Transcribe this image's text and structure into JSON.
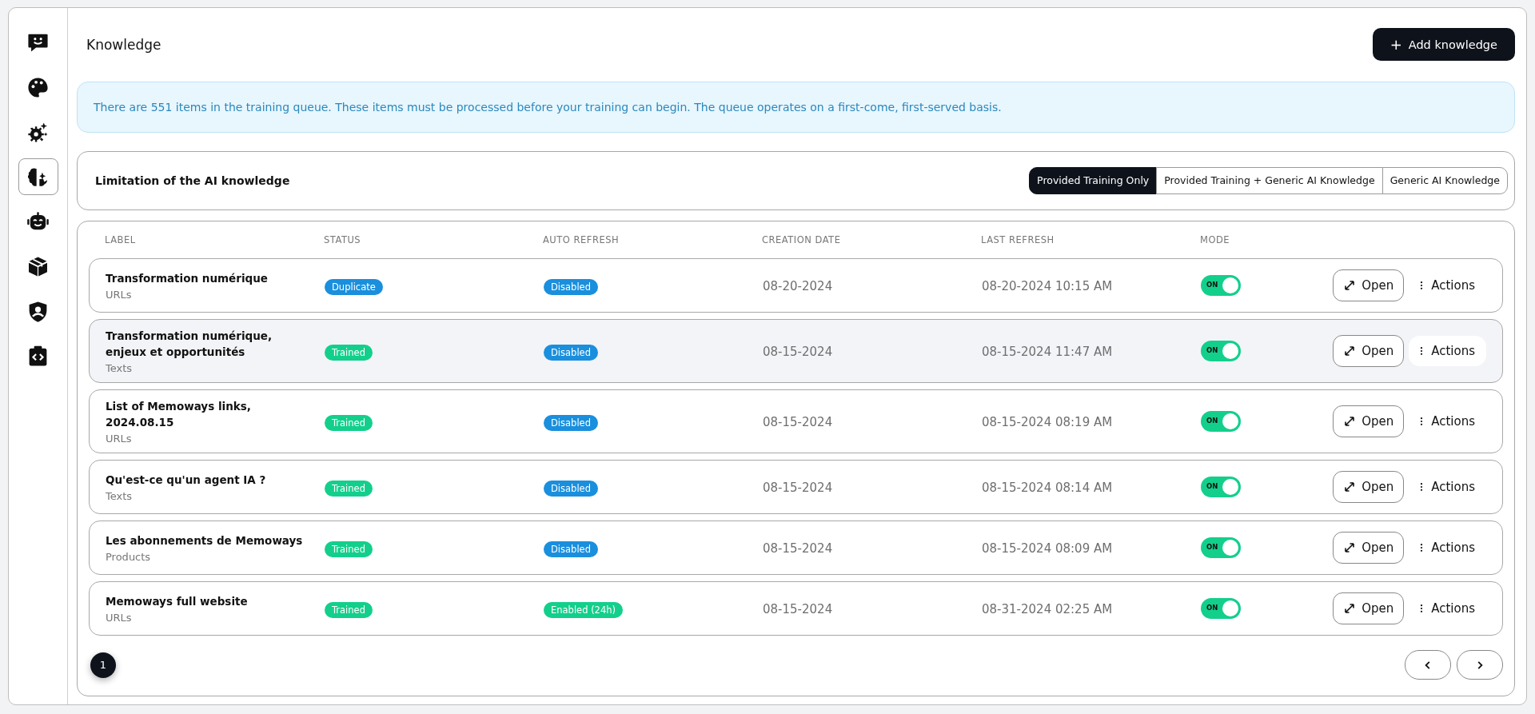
{
  "sidebar": {
    "items": [
      {
        "kind": "chat",
        "selected": false
      },
      {
        "kind": "palette",
        "selected": false
      },
      {
        "kind": "gears",
        "selected": false
      },
      {
        "kind": "brain",
        "selected": true
      },
      {
        "kind": "robot",
        "selected": false
      },
      {
        "kind": "box",
        "selected": false
      },
      {
        "kind": "shield",
        "selected": false
      },
      {
        "kind": "code",
        "selected": false
      }
    ]
  },
  "header": {
    "title": "Knowledge",
    "add_button": "Add knowledge",
    "add_icon": "+"
  },
  "notice": "There are 551 items in the training queue. These items must be processed before your training can begin. The queue operates on a first-come, first-served basis.",
  "limitation": {
    "label": "Limitation of the AI knowledge",
    "options": [
      {
        "label": "Provided Training Only",
        "selected": true
      },
      {
        "label": "Provided Training + Generic AI Knowledge",
        "selected": false
      },
      {
        "label": "Generic AI Knowledge",
        "selected": false
      }
    ]
  },
  "table": {
    "columns": [
      "LABEL",
      "STATUS",
      "AUTO REFRESH",
      "CREATION DATE",
      "LAST REFRESH",
      "MODE"
    ],
    "rows": [
      {
        "label": "Transformation numérique",
        "type": "URLs",
        "status": {
          "text": "Duplicate",
          "color": "#1a8fdd"
        },
        "auto_refresh": {
          "text": "Disabled",
          "color": "#1a8fdd"
        },
        "creation_date": "08-20-2024",
        "last_refresh": "08-20-2024 10:15 AM",
        "mode": {
          "on": true,
          "text": "ON"
        },
        "open": "Open",
        "actions": "Actions",
        "hovered": false
      },
      {
        "label": "Transformation numérique, enjeux et opportunités",
        "type": "Texts",
        "status": {
          "text": "Trained",
          "color": "#13cf8c"
        },
        "auto_refresh": {
          "text": "Disabled",
          "color": "#1a8fdd"
        },
        "creation_date": "08-15-2024",
        "last_refresh": "08-15-2024 11:47 AM",
        "mode": {
          "on": true,
          "text": "ON"
        },
        "open": "Open",
        "actions": "Actions",
        "hovered": true
      },
      {
        "label": "List of Memoways links, 2024.08.15",
        "type": "URLs",
        "status": {
          "text": "Trained",
          "color": "#13cf8c"
        },
        "auto_refresh": {
          "text": "Disabled",
          "color": "#1a8fdd"
        },
        "creation_date": "08-15-2024",
        "last_refresh": "08-15-2024 08:19 AM",
        "mode": {
          "on": true,
          "text": "ON"
        },
        "open": "Open",
        "actions": "Actions",
        "hovered": false
      },
      {
        "label": "Qu'est-ce qu'un agent IA ?",
        "type": "Texts",
        "status": {
          "text": "Trained",
          "color": "#13cf8c"
        },
        "auto_refresh": {
          "text": "Disabled",
          "color": "#1a8fdd"
        },
        "creation_date": "08-15-2024",
        "last_refresh": "08-15-2024 08:14 AM",
        "mode": {
          "on": true,
          "text": "ON"
        },
        "open": "Open",
        "actions": "Actions",
        "hovered": false
      },
      {
        "label": "Les abonnements de Memoways",
        "type": "Products",
        "status": {
          "text": "Trained",
          "color": "#13cf8c"
        },
        "auto_refresh": {
          "text": "Disabled",
          "color": "#1a8fdd"
        },
        "creation_date": "08-15-2024",
        "last_refresh": "08-15-2024 08:09 AM",
        "mode": {
          "on": true,
          "text": "ON"
        },
        "open": "Open",
        "actions": "Actions",
        "hovered": false
      },
      {
        "label": "Memoways full website",
        "type": "URLs",
        "status": {
          "text": "Trained",
          "color": "#13cf8c"
        },
        "auto_refresh": {
          "text": "Enabled (24h)",
          "color": "#13cf8c"
        },
        "creation_date": "08-15-2024",
        "last_refresh": "08-31-2024 02:25 AM",
        "mode": {
          "on": true,
          "text": "ON"
        },
        "open": "Open",
        "actions": "Actions",
        "hovered": false
      }
    ]
  },
  "pagination": {
    "pages": [
      {
        "label": "1",
        "selected": true
      }
    ]
  }
}
